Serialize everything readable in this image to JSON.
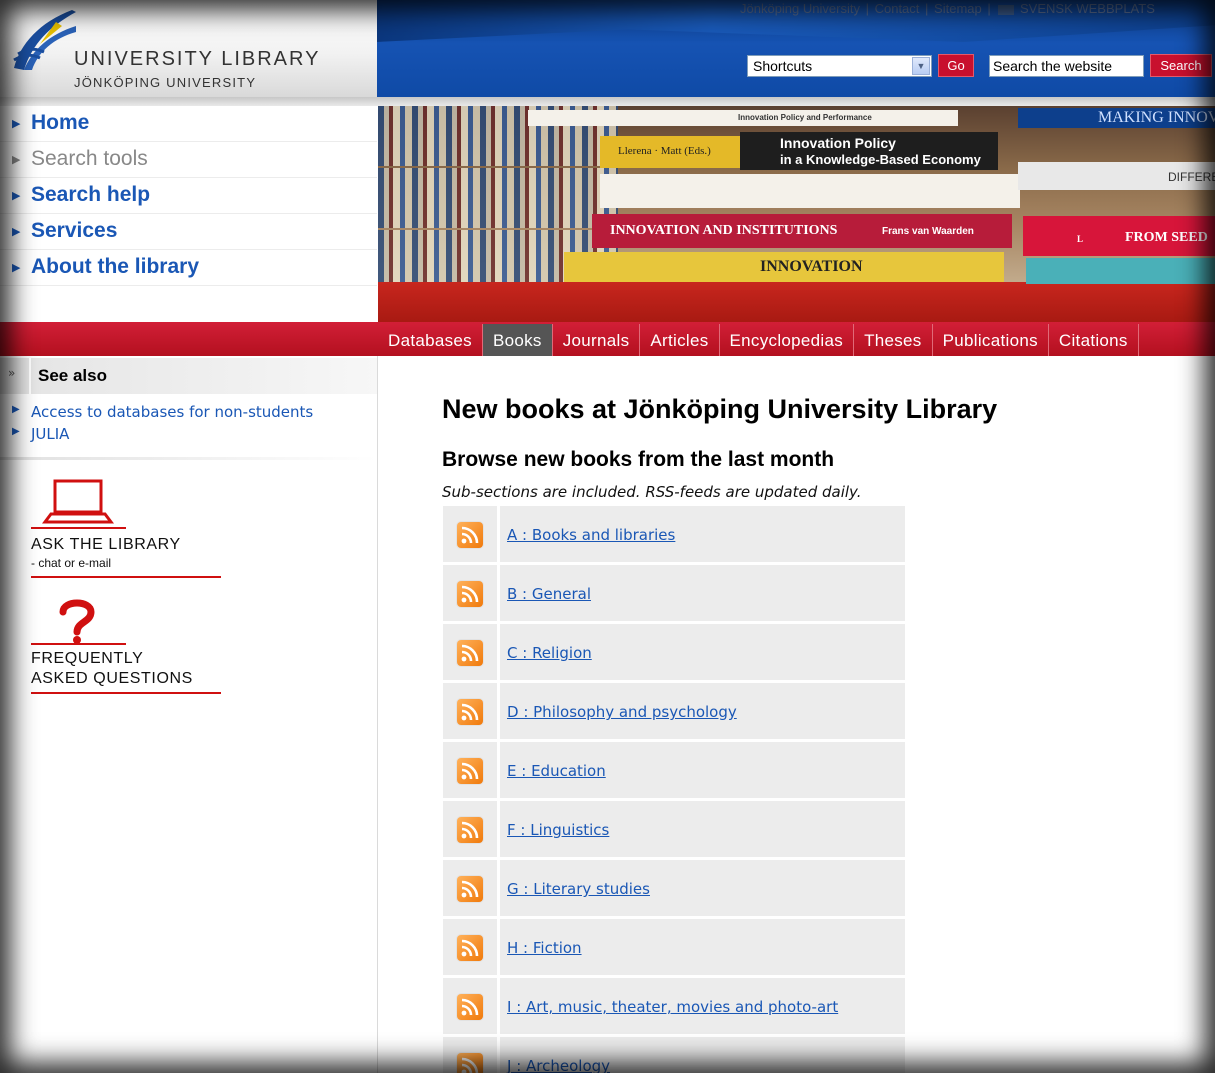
{
  "header": {
    "logo_title": "UNIVERSITY LIBRARY",
    "logo_subtitle": "JÖNKÖPING UNIVERSITY",
    "top_links": [
      "Jönköping University",
      "|",
      "Contact",
      "|",
      "Sitemap",
      "|",
      "SVENSK WEBBPLATS"
    ],
    "shortcuts_select": "Shortcuts",
    "go_label": "Go",
    "search_placeholder": "Search the website",
    "search_label": "Search"
  },
  "nav": {
    "items": [
      {
        "label": "Home"
      },
      {
        "label": "Search tools"
      },
      {
        "label": "Search help"
      },
      {
        "label": "Services"
      },
      {
        "label": "About the library"
      }
    ]
  },
  "banner": {
    "books": [
      "Innovation Policy and Performance",
      "Llerena · Matt (Eds.)",
      "Innovation Policy",
      "in a Knowledge-Based Economy",
      "INNOVATION AND INSTITUTIONS",
      "Frans van Waarden",
      "INNOVATION",
      "FROM SEED",
      "MAKING INNOVAT",
      "LINK",
      "DIFFERE"
    ]
  },
  "tabs": [
    "Databases",
    "Books",
    "Journals",
    "Articles",
    "Encyclopedias",
    "Theses",
    "Publications",
    "Citations"
  ],
  "sidebar": {
    "see_also_title": "See also",
    "links": [
      "Access to databases for non-students",
      "JULIA"
    ],
    "ask_title": "ASK THE LIBRARY",
    "ask_sub": "- chat or e-mail",
    "faq_line1": "FREQUENTLY",
    "faq_line2": "ASKED QUESTIONS"
  },
  "main": {
    "title": "New books at Jönköping University Library",
    "subtitle": "Browse new books from the last month",
    "note": "Sub-sections are included. RSS-feeds are updated daily.",
    "categories": [
      "A : Books and libraries",
      "B : General",
      "C : Religion",
      "D : Philosophy and psychology",
      "E : Education",
      "F : Linguistics",
      "G : Literary studies",
      "H : Fiction",
      "I : Art, music, theater, movies and photo-art",
      "J : Archeology"
    ]
  }
}
